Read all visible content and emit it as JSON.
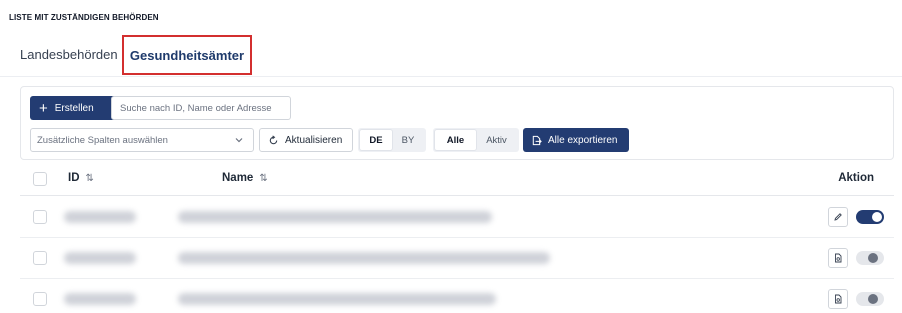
{
  "page": {
    "heading": "LISTE MIT ZUSTÄNDIGEN BEHÖRDEN"
  },
  "tabs": [
    {
      "label": "Landesbehörden",
      "active": false
    },
    {
      "label": "Gesundheitsämter",
      "active": true
    }
  ],
  "toolbar": {
    "create_label": "Erstellen",
    "search_placeholder": "Suche nach ID, Name oder Adresse",
    "columns_select_placeholder": "Zusätzliche Spalten auswählen",
    "refresh_label": "Aktualisieren",
    "language_options": [
      "DE",
      "BY"
    ],
    "language_selected": "DE",
    "status_options": [
      "Alle",
      "Aktiv"
    ],
    "status_selected": "Alle",
    "export_label": "Alle exportieren"
  },
  "table": {
    "columns": {
      "id": "ID",
      "name": "Name",
      "action": "Aktion"
    },
    "rows": [
      {
        "active": true,
        "action_icon": "pencil-icon"
      },
      {
        "active": false,
        "action_icon": "document-icon"
      },
      {
        "active": false,
        "action_icon": "document-icon"
      }
    ]
  },
  "colors": {
    "primary": "#233c72",
    "highlight_border": "#d32f2f",
    "active_tab_text": "#1e3a6b"
  }
}
